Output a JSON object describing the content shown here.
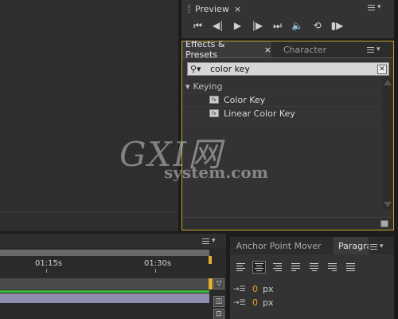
{
  "watermark": {
    "big": "GXI网",
    "small": "system.com"
  },
  "preview": {
    "tab_label": "Preview",
    "close": "×",
    "controls": [
      "first-frame",
      "prev-frame",
      "play",
      "next-frame",
      "last-frame",
      "audio",
      "loop",
      "ram-preview"
    ]
  },
  "effects": {
    "tab_label": "Effects & Presets",
    "tab_close": "×",
    "character_tab": "Character",
    "search": {
      "value": "color key"
    },
    "tree": {
      "category": "Keying",
      "items": [
        "Color Key",
        "Linear Color Key"
      ]
    }
  },
  "timeline": {
    "ruler": [
      "01:15s",
      "01:30s"
    ]
  },
  "paragraph_panel": {
    "tab_anchor": "Anchor Point Mover",
    "tab_paragraph": "Paragraph",
    "indent_left": {
      "value": "0",
      "unit": "px"
    },
    "indent_first": {
      "value": "0",
      "unit": "px"
    }
  },
  "colors": {
    "panel_highlight": "#c9a52a",
    "value_orange": "#e8a020",
    "track_green": "#3cba3c",
    "layer_lavender": "#8e8caf"
  }
}
